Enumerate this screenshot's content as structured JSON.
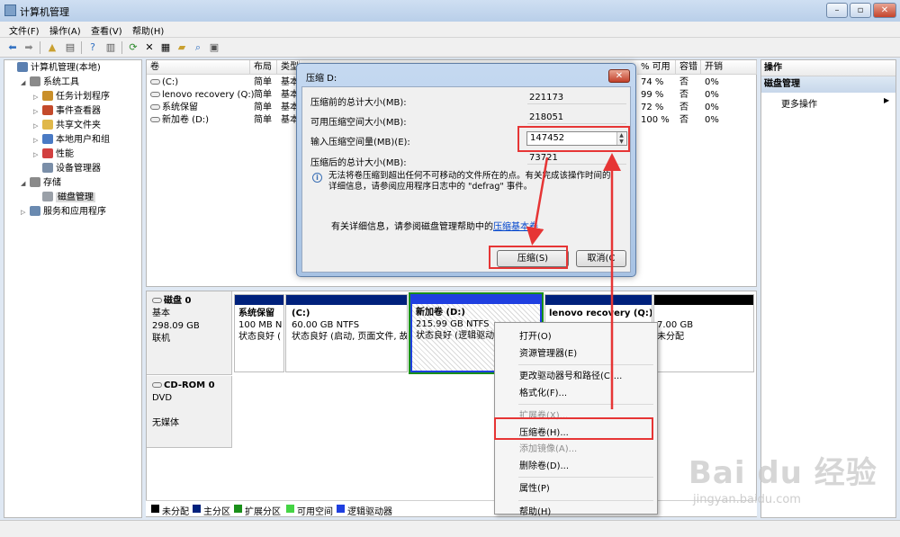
{
  "window": {
    "title": "计算机管理",
    "minimize": "–",
    "maximize": "▫",
    "close": "✕"
  },
  "menu": [
    "文件(F)",
    "操作(A)",
    "查看(V)",
    "帮助(H)"
  ],
  "tree": [
    {
      "label": "计算机管理(本地)",
      "indent": 0,
      "expander": "",
      "icon_color": "#5a7fb0"
    },
    {
      "label": "系统工具",
      "indent": 1,
      "expander": "◢",
      "icon_color": "#8a8a8a"
    },
    {
      "label": "任务计划程序",
      "indent": 2,
      "expander": "▷",
      "icon_color": "#c98f2a"
    },
    {
      "label": "事件查看器",
      "indent": 2,
      "expander": "▷",
      "icon_color": "#c44a2b"
    },
    {
      "label": "共享文件夹",
      "indent": 2,
      "expander": "▷",
      "icon_color": "#e0b84a"
    },
    {
      "label": "本地用户和组",
      "indent": 2,
      "expander": "▷",
      "icon_color": "#4a7ac4"
    },
    {
      "label": "性能",
      "indent": 2,
      "expander": "▷",
      "icon_color": "#d24040"
    },
    {
      "label": "设备管理器",
      "indent": 2,
      "expander": "",
      "icon_color": "#7a8ea8"
    },
    {
      "label": "存储",
      "indent": 1,
      "expander": "◢",
      "icon_color": "#8a8a8a"
    },
    {
      "label": "磁盘管理",
      "indent": 2,
      "expander": "",
      "icon_color": "#9aa0a8",
      "selected": true
    },
    {
      "label": "服务和应用程序",
      "indent": 1,
      "expander": "▷",
      "icon_color": "#6a8ab0"
    }
  ],
  "volume_columns": [
    "卷",
    "布局",
    "类型",
    "% 可用",
    "容错",
    "开销"
  ],
  "volumes": [
    {
      "name": "(C:)",
      "layout": "简单",
      "type": "基本",
      "pct": "74 %",
      "fault": "否",
      "overhead": "0%"
    },
    {
      "name": "lenovo recovery (Q:)",
      "layout": "简单",
      "type": "基本",
      "pct": "99 %",
      "fault": "否",
      "overhead": "0%"
    },
    {
      "name": "系统保留",
      "layout": "简单",
      "type": "基本",
      "pct": "72 %",
      "fault": "否",
      "overhead": "0%"
    },
    {
      "name": "新加卷 (D:)",
      "layout": "简单",
      "type": "基本",
      "pct": "100 %",
      "fault": "否",
      "overhead": "0%"
    }
  ],
  "disk0": {
    "name": "磁盘 0",
    "kind": "基本",
    "size": "298.09 GB",
    "status": "联机",
    "partitions": [
      {
        "name": "系统保留",
        "l2": "100 MB N",
        "l3": "状态良好 (",
        "color": "#00217c"
      },
      {
        "name": "(C:)",
        "l2": "60.00 GB NTFS",
        "l3": "状态良好 (启动, 页面文件, 故",
        "color": "#00217c"
      },
      {
        "name": "新加卷 (D:)",
        "l2": "215.99 GB NTFS",
        "l3": "状态良好 (逻辑驱动",
        "color": "#1f3fe0"
      },
      {
        "name": "lenovo recovery (Q:)",
        "l2": "",
        "l3": "",
        "color": "#00217c"
      },
      {
        "name": "",
        "l2": "7.00 GB",
        "l3": "未分配",
        "color": "#000000"
      }
    ]
  },
  "cdrom": {
    "name": "CD-ROM 0",
    "kind": "DVD",
    "status": "无媒体"
  },
  "legend": [
    {
      "label": "未分配",
      "color": "#000000"
    },
    {
      "label": "主分区",
      "color": "#00217c"
    },
    {
      "label": "扩展分区",
      "color": "#1a8f1a"
    },
    {
      "label": "可用空间",
      "color": "#44d444"
    },
    {
      "label": "逻辑驱动器",
      "color": "#1f3fe0"
    }
  ],
  "actions": {
    "header": "操作",
    "section": "磁盘管理",
    "more": "更多操作"
  },
  "dialog": {
    "title": "压缩 D:",
    "close": "✕",
    "total_before_label": "压缩前的总计大小(MB):",
    "total_before": "221173",
    "available_label": "可用压缩空间大小(MB):",
    "available": "218051",
    "input_label": "输入压缩空间量(MB)(E):",
    "input_value": "147452",
    "after_label": "压缩后的总计大小(MB):",
    "after": "73721",
    "info_line1": "无法将卷压缩到超出任何不可移动的文件所在的点。有关完成该操作时间的",
    "info_line2": "详细信息，请参阅应用程序日志中的 \"defrag\" 事件。",
    "help_prefix": "有关详细信息，请参阅磁盘管理帮助中的",
    "help_link": "压缩基本卷",
    "ok": "压缩(S)",
    "cancel": "取消(C"
  },
  "context_menu": [
    {
      "label": "打开(O)",
      "disabled": false
    },
    {
      "label": "资源管理器(E)",
      "disabled": false
    },
    {
      "sep": true
    },
    {
      "label": "更改驱动器号和路径(C)...",
      "disabled": false
    },
    {
      "label": "格式化(F)...",
      "disabled": false
    },
    {
      "sep": true
    },
    {
      "label": "扩展卷(X)...",
      "disabled": true
    },
    {
      "label": "压缩卷(H)...",
      "disabled": false
    },
    {
      "label": "添加镜像(A)...",
      "disabled": true
    },
    {
      "label": "删除卷(D)...",
      "disabled": false
    },
    {
      "sep": true
    },
    {
      "label": "属性(P)",
      "disabled": false
    },
    {
      "sep": true
    },
    {
      "label": "帮助(H)",
      "disabled": false
    }
  ],
  "watermark": {
    "logo": "Bai du 经验",
    "url": "jingyan.baidu.com"
  },
  "accent": {
    "annotation": "#e63535"
  }
}
